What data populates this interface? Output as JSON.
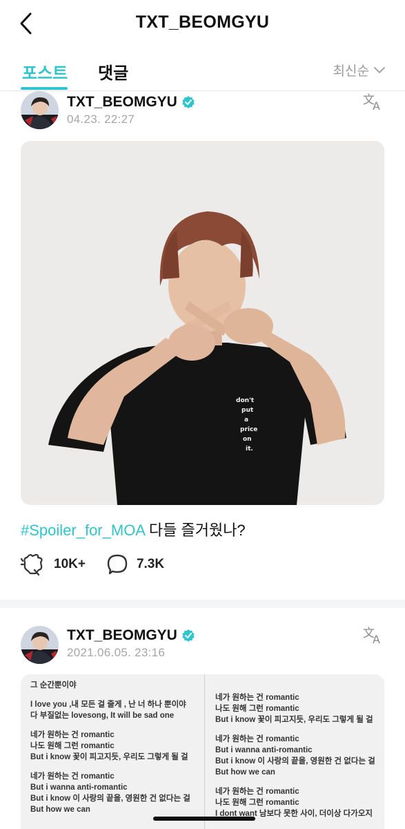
{
  "header": {
    "title": "TXT_BEOMGYU",
    "back_icon": "chevron-left-icon"
  },
  "tabs": [
    {
      "label": "포스트",
      "active": true
    },
    {
      "label": "댓글",
      "active": false
    }
  ],
  "sort": {
    "label": "최신순",
    "icon": "chevron-down-icon"
  },
  "accent_color": "#2ec5cf",
  "posts": [
    {
      "author": "TXT_BEOMGYU",
      "verified": true,
      "timestamp": "04.23. 22:27",
      "hashtag": "#Spoiler_for_MOA",
      "caption_text": " 다들 즐거웠나?",
      "shirt_text": "don't put a price on it",
      "likes": "10K+",
      "comments": "7.3K"
    },
    {
      "author": "TXT_BEOMGYU",
      "verified": true,
      "timestamp": "2021.06.05. 23:16",
      "lyrics_left": [
        "그 순간뿐이야",
        "",
        "I love you ,내 모든 걸 줄게 ,  난 너 하나 뿐이야",
        "다 부질없는 lovesong, It will be sad one",
        "",
        "네가 원하는 건 romantic",
        "나도 원해 그런 romantic",
        "But i know 꽃이 피고지듯, 우리도 그렇게 될 걸",
        "",
        "네가 원하는 건 romantic",
        "But i wanna anti-romantic",
        "But i know 이 사랑의 끝을, 영원한 건 없다는 걸",
        "But how we can"
      ],
      "lyrics_right": [
        "네가 원하는 건 romantic",
        "나도 원해 그런 romantic",
        "But i know 꽃이 피고지듯, 우리도 그렇게 될 걸",
        "",
        "네가 원하는 건 romantic",
        "But i wanna anti-romantic",
        "But i know 이 사랑의 끝을, 영원한 건 없다는 걸",
        "But how we can",
        "",
        "네가 원하는 건 romantic",
        "나도 원해 그런 romantic",
        "I dont want 남보다 못한 사이, 더이상 다가오지"
      ]
    }
  ]
}
